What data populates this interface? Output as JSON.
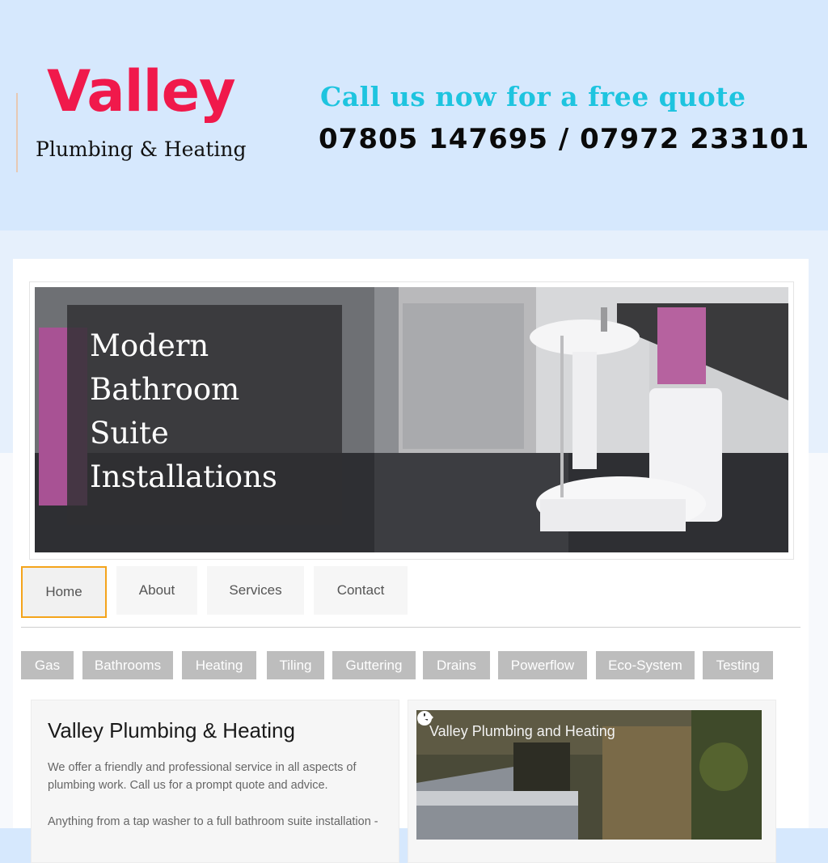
{
  "header": {
    "logo_main": "Valley",
    "logo_sub": "Plumbing & Heating",
    "call_line": "Call us now for a free quote",
    "phones": "07805 147695 / 07972 233101"
  },
  "hero": {
    "caption_lines": [
      "Modern",
      "Bathroom",
      "Suite",
      "Installations"
    ]
  },
  "main_nav": {
    "items": [
      {
        "label": "Home",
        "active": true
      },
      {
        "label": "About",
        "active": false
      },
      {
        "label": "Services",
        "active": false
      },
      {
        "label": "Contact",
        "active": false
      }
    ]
  },
  "sub_nav": {
    "items": [
      "Gas",
      "Bathrooms",
      "Heating",
      "Tiling",
      "Guttering",
      "Drains",
      "Powerflow",
      "Eco-System",
      "Testing"
    ]
  },
  "about": {
    "title": "Valley Plumbing & Heating",
    "para1": "We offer a friendly and professional service in all aspects of plumbing work. Call us for a prompt quote and advice.",
    "para2": "Anything from a tap washer to a full bathroom suite installation -"
  },
  "video": {
    "title": "Valley Plumbing and Heating",
    "icons": [
      "clock-icon",
      "share-icon"
    ]
  },
  "colors": {
    "logo_red": "#f0194b",
    "call_cyan": "#1ec4df",
    "active_border": "#f4a41b",
    "subnav_gray": "#bdbdbd"
  }
}
